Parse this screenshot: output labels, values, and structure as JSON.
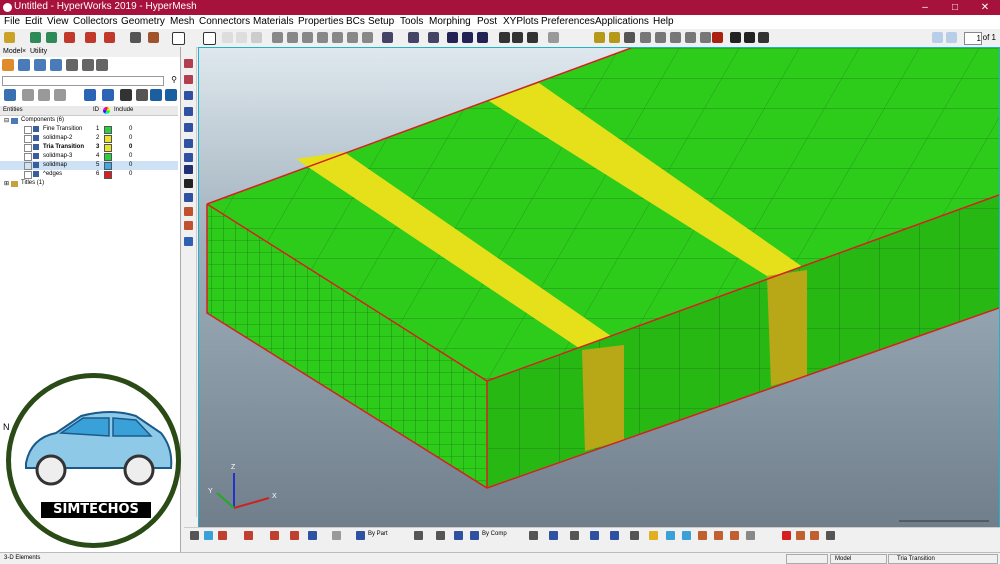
{
  "window": {
    "title": "Untitled - HyperWorks 2019 - HyperMesh",
    "minimize": "–",
    "maximize": "□",
    "close": "✕"
  },
  "menu": [
    "File",
    "Edit",
    "View",
    "Collectors",
    "Geometry",
    "Mesh",
    "Connectors",
    "Materials",
    "Properties",
    "BCs",
    "Setup",
    "Tools",
    "Morphing",
    "Post",
    "XYPlots",
    "Preferences",
    "Applications",
    "Help"
  ],
  "toolbar": {
    "page_value": "1",
    "page_of": "of 1"
  },
  "panel": {
    "tabs": [
      "Model",
      "×",
      "Utility"
    ],
    "search_placeholder": "",
    "columns": {
      "entities": "Entities",
      "id": "ID",
      "include": "Include"
    },
    "tree": [
      {
        "label": "Components (6)",
        "id": "",
        "include": "",
        "color": ""
      },
      {
        "label": "Fine Transition",
        "id": "1",
        "include": "0",
        "color": "#2ecc40"
      },
      {
        "label": "solidmap-2",
        "id": "2",
        "include": "0",
        "color": "#e8e32a"
      },
      {
        "label": "Tria Transition",
        "id": "3",
        "include": "0",
        "color": "#e8e32a"
      },
      {
        "label": "solidmap-3",
        "id": "4",
        "include": "0",
        "color": "#2ecc40"
      },
      {
        "label": "solidmap",
        "id": "5",
        "include": "0",
        "color": "#3fa9e0"
      },
      {
        "label": "^edges",
        "id": "6",
        "include": "0",
        "color": "#d62020"
      },
      {
        "label": "Titles (1)",
        "id": "",
        "include": "",
        "color": ""
      }
    ],
    "cut_label": "N"
  },
  "viewport": {
    "axes": {
      "x": "X",
      "y": "Y",
      "z": "Z"
    },
    "colors": {
      "green": "#2ecc1a",
      "yellow": "#e6e01a",
      "edge": "#d62020",
      "mesh": "#1a7a1a"
    }
  },
  "bottom": {
    "by_part": "By Part",
    "by_comp": "By Comp"
  },
  "status": {
    "left": "3-D Elements",
    "model": "Model",
    "component": "Tria Transition"
  },
  "logo": {
    "brand": "SIMTECHOS"
  }
}
